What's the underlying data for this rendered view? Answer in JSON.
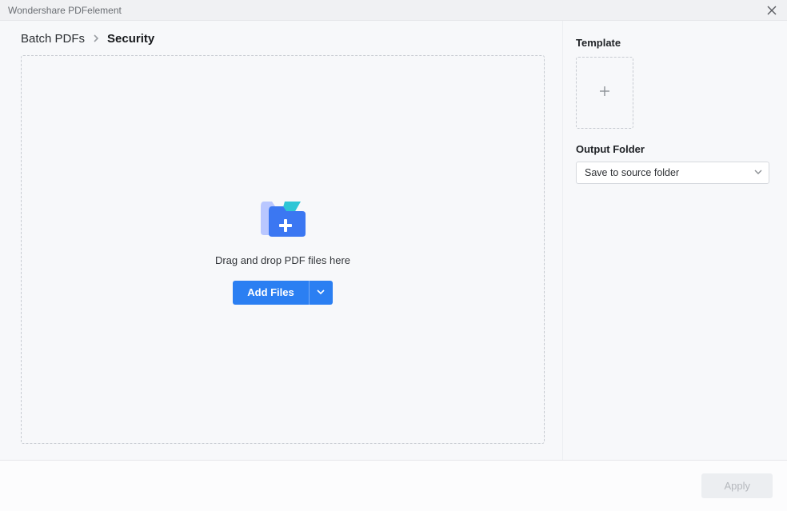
{
  "window": {
    "title": "Wondershare PDFelement"
  },
  "breadcrumb": {
    "root": "Batch PDFs",
    "current": "Security"
  },
  "dropzone": {
    "hint": "Drag and drop PDF files here",
    "button_label": "Add Files"
  },
  "sidebar": {
    "template_label": "Template",
    "output_label": "Output Folder",
    "output_selected": "Save to source folder"
  },
  "footer": {
    "apply_label": "Apply"
  }
}
